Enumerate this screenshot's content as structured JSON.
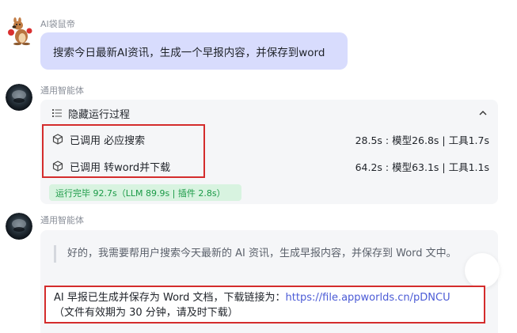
{
  "user_message": {
    "sender": "AI袋鼠帝",
    "text": "搜索今日最新AI资讯，生成一个早报内容，并保存到word"
  },
  "agent_message_1": {
    "sender": "通用智能体",
    "process_toggle_label": "隐藏运行过程",
    "tool_calls": [
      {
        "label": "已调用 必应搜索",
        "stats": "28.5s : 模型26.8s | 工具1.7s"
      },
      {
        "label": "已调用 转word并下载",
        "stats": "64.2s : 模型63.1s | 工具1.1s"
      }
    ],
    "completion_badge": "运行完毕 92.7s（LLM 89.9s | 插件 2.8s）"
  },
  "agent_message_2": {
    "sender": "通用智能体",
    "thought": "好的，我需要帮用户搜索今天最新的 AI 资讯，生成早报内容，并保存到 Word 文中。",
    "result_prefix": "AI 早报已生成并保存为 Word 文档，下载链接为：",
    "result_link": "https://file.appworlds.cn/pDNCU",
    "result_note": "（文件有效期为 30 分钟，请及时下载）"
  },
  "colors": {
    "user_bubble": "#d8dcfd",
    "card_bg": "#f5f6f8",
    "highlight_border": "#d42c2c",
    "badge_bg": "#d8f3e0",
    "badge_text": "#1a9a46",
    "link": "#4b5bd6"
  },
  "icons": [
    "kangaroo-avatar-icon",
    "agent-avatar-icon",
    "list-icon",
    "chevron-up-icon",
    "cube-icon"
  ]
}
